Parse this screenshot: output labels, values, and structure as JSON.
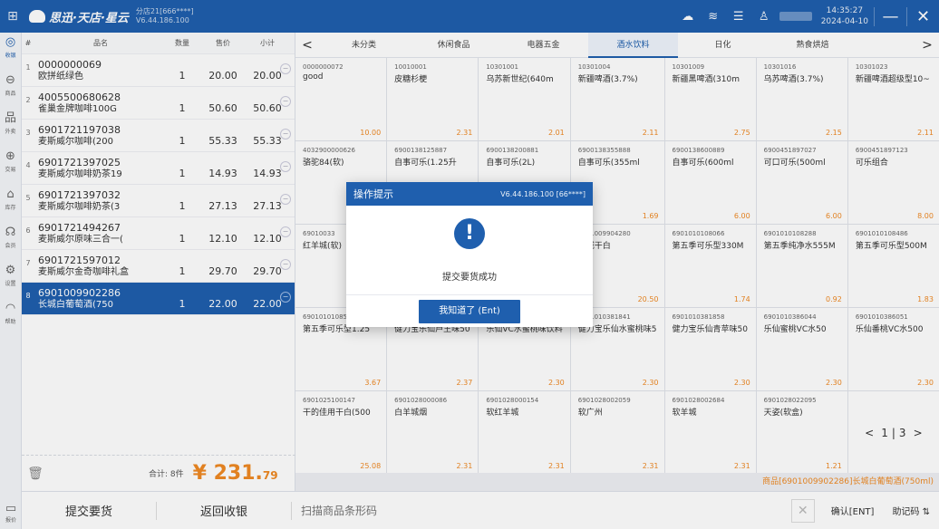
{
  "titlebar": {
    "brand": "思迅·天店·星云",
    "store": "分店21[666****]",
    "version": "V6.44.186.100",
    "time": "14:35:27",
    "date": "2024-04-10",
    "minimize": "—",
    "close": "✕"
  },
  "nav": [
    {
      "icon": "◎",
      "label": "收银",
      "name": "nav-cashier"
    },
    {
      "icon": "⊖",
      "label": "商品",
      "name": "nav-goods"
    },
    {
      "icon": "品",
      "label": "外卖",
      "name": "nav-takeout"
    },
    {
      "icon": "⊕",
      "label": "交易",
      "name": "nav-trade"
    },
    {
      "icon": "⌂",
      "label": "库存",
      "name": "nav-stock"
    },
    {
      "icon": "☊",
      "label": "会员",
      "name": "nav-member"
    },
    {
      "icon": "⚙",
      "label": "设置",
      "name": "nav-settings"
    },
    {
      "icon": "◠",
      "label": "帮助",
      "name": "nav-help"
    }
  ],
  "nav_bottom": {
    "icon": "▭",
    "label": "报价"
  },
  "cart": {
    "headers": {
      "index": "#",
      "name": "品名",
      "qty": "数量",
      "price": "售价",
      "subtotal": "小计"
    },
    "rows": [
      {
        "idx": "1",
        "code": "0000000069",
        "name": "欧拼纸绿色",
        "qty": "1",
        "price": "20.00",
        "sub": "20.00"
      },
      {
        "idx": "2",
        "code": "4005500680628",
        "name": "雀巢金牌咖啡100G",
        "qty": "1",
        "price": "50.60",
        "sub": "50.60"
      },
      {
        "idx": "3",
        "code": "6901721197038",
        "name": "麦斯威尔咖啡(200",
        "qty": "1",
        "price": "55.33",
        "sub": "55.33"
      },
      {
        "idx": "4",
        "code": "6901721397025",
        "name": "麦斯威尔咖啡奶茶19",
        "qty": "1",
        "price": "14.93",
        "sub": "14.93"
      },
      {
        "idx": "5",
        "code": "6901721397032",
        "name": "麦斯威尔咖啡奶茶(3",
        "qty": "1",
        "price": "27.13",
        "sub": "27.13"
      },
      {
        "idx": "6",
        "code": "6901721494267",
        "name": "麦斯威尔原味三合一(",
        "qty": "1",
        "price": "12.10",
        "sub": "12.10"
      },
      {
        "idx": "7",
        "code": "6901721597012",
        "name": "麦斯威尔金奇咖啡礼盒",
        "qty": "1",
        "price": "29.70",
        "sub": "29.70"
      },
      {
        "idx": "8",
        "code": "6901009902286",
        "name": "长城白葡萄酒(750",
        "qty": "1",
        "price": "22.00",
        "sub": "22.00"
      }
    ],
    "count_label": "合计: 8件",
    "total_main": "¥ 231.",
    "total_dec": "79"
  },
  "bottombar": {
    "submit": "提交要货",
    "back": "返回收银",
    "scan_placeholder": "扫描商品条形码",
    "clear": "✕",
    "confirm": "确认[ENT]",
    "helper": "助记码 ⇅"
  },
  "categories": {
    "prev": "<",
    "next": ">",
    "tabs": [
      "未分类",
      "休闲食品",
      "电器五金",
      "酒水饮料",
      "日化",
      "熟食烘焙"
    ],
    "active_index": 3
  },
  "products": [
    {
      "code": "0000000072",
      "name": "good",
      "price": "10.00"
    },
    {
      "code": "10010001",
      "name": "皮糖杉梗",
      "price": "2.31"
    },
    {
      "code": "10301001",
      "name": "乌苏新世纪(640m",
      "price": "2.01"
    },
    {
      "code": "10301004",
      "name": "新疆啤酒(3.7%)",
      "price": "2.11"
    },
    {
      "code": "10301009",
      "name": "新疆黑啤酒(310m",
      "price": "2.75"
    },
    {
      "code": "10301016",
      "name": "乌苏啤酒(3.7%)",
      "price": "2.15"
    },
    {
      "code": "10301023",
      "name": "新疆啤酒超级型10~",
      "price": "2.11"
    },
    {
      "code": "4032900000626",
      "name": "骆驼84(软)",
      "price": ""
    },
    {
      "code": "6900138125887",
      "name": "自事可乐(1.25升",
      "price": ""
    },
    {
      "code": "6900138200881",
      "name": "自事可乐(2L)",
      "price": ""
    },
    {
      "code": "6900138355888",
      "name": "自事可乐(355ml",
      "price": "1.69"
    },
    {
      "code": "6900138600889",
      "name": "自事可乐(600ml",
      "price": "6.00"
    },
    {
      "code": "6900451897027",
      "name": "可口可乐(500ml",
      "price": "6.00"
    },
    {
      "code": "6900451897123",
      "name": "可乐组合",
      "price": "8.00"
    },
    {
      "code": "69010033",
      "name": "红羊城(软)",
      "price": ""
    },
    {
      "code": "",
      "name": "",
      "price": ""
    },
    {
      "code": "",
      "name": "",
      "price": ""
    },
    {
      "code": "6901009904280",
      "name": "长城干白",
      "price": "20.50"
    },
    {
      "code": "6901010108066",
      "name": "第五季可乐型330M",
      "price": "1.74"
    },
    {
      "code": "6901010108288",
      "name": "第五季纯净水555M",
      "price": "0.92"
    },
    {
      "code": "6901010108486",
      "name": "第五季可乐型500M",
      "price": "1.83"
    },
    {
      "code": "6901010108589",
      "name": "第五季可乐型1.25",
      "price": "3.67"
    },
    {
      "code": "6901010381827",
      "name": "健力宝乐仙芦王味50",
      "price": "2.37"
    },
    {
      "code": "6901010381834",
      "name": "乐仙VC水蜜桃味饮料",
      "price": "2.30"
    },
    {
      "code": "6901010381841",
      "name": "健力宝乐仙水蜜桃味5",
      "price": "2.30"
    },
    {
      "code": "6901010381858",
      "name": "健力宝乐仙青苹味50",
      "price": "2.30"
    },
    {
      "code": "6901010386044",
      "name": "乐仙蜜桃VC水50",
      "price": "2.30"
    },
    {
      "code": "6901010386051",
      "name": "乐仙番桃VC水500",
      "price": "2.30"
    },
    {
      "code": "6901025100147",
      "name": "干的佳用干白(500",
      "price": "25.08"
    },
    {
      "code": "6901028000086",
      "name": "白羊城烟",
      "price": "2.31"
    },
    {
      "code": "6901028000154",
      "name": "软红羊城",
      "price": "2.31"
    },
    {
      "code": "6901028002059",
      "name": "软广州",
      "price": "2.31"
    },
    {
      "code": "6901028002684",
      "name": "软羊城",
      "price": "2.31"
    },
    {
      "code": "6901028022095",
      "name": "天姿(软盒)",
      "price": "1.21"
    }
  ],
  "pager": {
    "prev": "<",
    "current": "1",
    "sep": "|",
    "total": "3",
    "next": ">"
  },
  "status_strip": "商品[6901009902286]长城白葡萄酒(750ml)",
  "modal": {
    "title": "操作提示",
    "version": "V6.44.186.100 [66****]",
    "icon": "!",
    "message": "提交要货成功",
    "button": "我知道了 (Ent)"
  },
  "colors": {
    "primary": "#1f5fae",
    "accent": "#f08a24"
  }
}
